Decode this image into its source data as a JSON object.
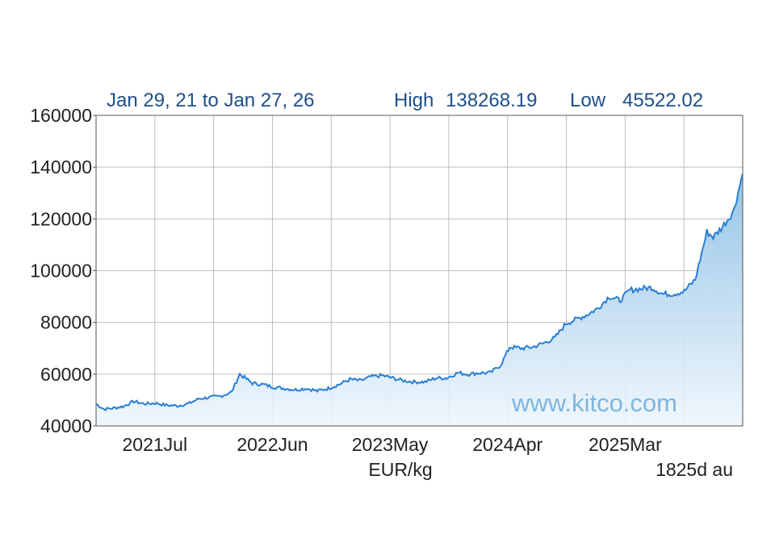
{
  "header": {
    "range_label": "Jan 29, 21 to Jan 27, 26",
    "high_label": "High",
    "high_value": "138268.19",
    "low_label": "Low",
    "low_value": "45522.02"
  },
  "footer": {
    "unit_label": "EUR/kg",
    "period_label": "1825d au",
    "watermark": "www.kitco.com"
  },
  "colors": {
    "line": "#2a7fd4",
    "fill_top": "#8fc1e6",
    "fill_bottom": "#eef6fc",
    "grid": "#bdbdbd",
    "frame": "#555555",
    "header_text": "#1f4e8c"
  },
  "chart_data": {
    "type": "area",
    "ylim": [
      40000,
      160000
    ],
    "y_ticks": [
      "160000",
      "140000",
      "120000",
      "100000",
      "80000",
      "60000",
      "40000"
    ],
    "x_ticks": [
      "2021Jul",
      "2022Jun",
      "2023May",
      "2024Apr",
      "2025Mar"
    ],
    "grid": true,
    "x_range": [
      "2021-01-29",
      "2026-01-27"
    ],
    "series": [
      {
        "x": [
          "2021-01-29",
          "2021-02-20",
          "2021-03-15",
          "2021-04-15",
          "2021-05-15",
          "2021-06-15",
          "2021-07-15",
          "2021-08-15",
          "2021-09-15",
          "2021-10-15",
          "2021-11-15",
          "2021-12-15",
          "2022-01-15",
          "2022-02-15",
          "2022-03-10",
          "2022-04-15",
          "2022-05-15",
          "2022-06-15",
          "2022-07-15",
          "2022-08-15",
          "2022-09-15",
          "2022-10-15",
          "2022-11-15",
          "2022-12-15",
          "2023-01-15",
          "2023-02-15",
          "2023-03-15",
          "2023-04-15",
          "2023-05-15",
          "2023-06-15",
          "2023-07-15",
          "2023-08-15",
          "2023-09-15",
          "2023-10-15",
          "2023-11-15",
          "2023-12-15",
          "2024-01-15",
          "2024-02-15",
          "2024-03-15",
          "2024-04-10",
          "2024-05-15",
          "2024-06-15",
          "2024-07-15",
          "2024-08-15",
          "2024-09-15",
          "2024-10-20",
          "2024-11-15",
          "2024-12-15",
          "2025-01-15",
          "2025-02-15",
          "2025-03-15",
          "2025-04-15",
          "2025-05-15",
          "2025-06-15",
          "2025-07-15",
          "2025-08-15",
          "2025-09-15",
          "2025-10-18",
          "2025-11-05",
          "2025-12-01",
          "2026-01-01",
          "2026-01-27"
        ],
        "y": [
          48500,
          46500,
          46800,
          47500,
          49500,
          48500,
          48800,
          48000,
          47800,
          48500,
          50500,
          51000,
          51500,
          53000,
          60000,
          56500,
          56000,
          55000,
          54500,
          54000,
          54500,
          53500,
          54500,
          56000,
          58000,
          57500,
          59000,
          59500,
          58500,
          57500,
          57000,
          57000,
          58500,
          58500,
          60500,
          60000,
          60500,
          60500,
          63500,
          70500,
          70000,
          70500,
          72000,
          74000,
          79500,
          81500,
          83000,
          85500,
          90000,
          88500,
          92500,
          93000,
          93500,
          91000,
          91000,
          92000,
          96500,
          115000,
          113000,
          117000,
          123000,
          137500
        ]
      }
    ]
  }
}
